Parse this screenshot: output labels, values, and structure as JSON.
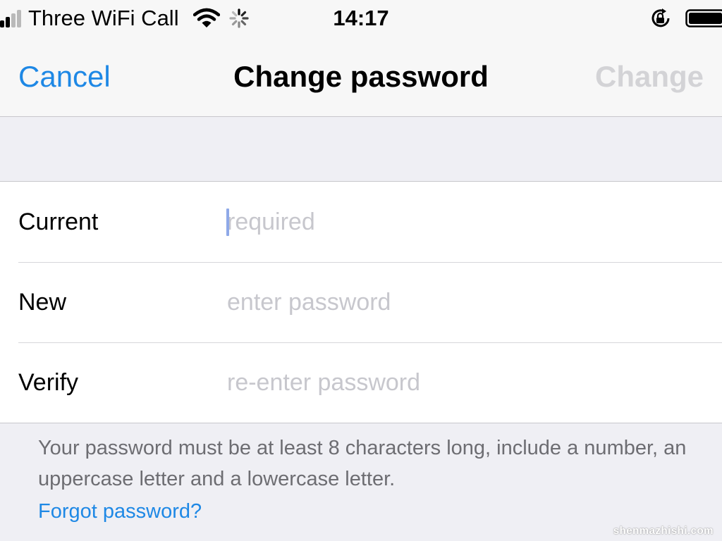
{
  "status_bar": {
    "carrier": "Three WiFi Call",
    "time": "14:17",
    "icons": [
      "signal-icon",
      "wifi-icon",
      "spinner-icon",
      "rotation-lock-icon",
      "battery-icon"
    ]
  },
  "nav": {
    "cancel_label": "Cancel",
    "title": "Change password",
    "change_label": "Change"
  },
  "form": {
    "rows": [
      {
        "label": "Current",
        "value": "",
        "placeholder": "required"
      },
      {
        "label": "New",
        "value": "",
        "placeholder": "enter password"
      },
      {
        "label": "Verify",
        "value": "",
        "placeholder": "re-enter password"
      }
    ]
  },
  "footer": {
    "hint": "Your password must be at least 8 characters long, include a number, an uppercase letter and a lowercase letter.",
    "forgot_link": "Forgot password?"
  },
  "watermark": "shenmazhishi.com",
  "colors": {
    "accent": "#1e88e5",
    "disabled": "#d3d3d6",
    "background": "#efeff4",
    "placeholder": "#c7c7cd",
    "secondary_text": "#6d6d72"
  }
}
